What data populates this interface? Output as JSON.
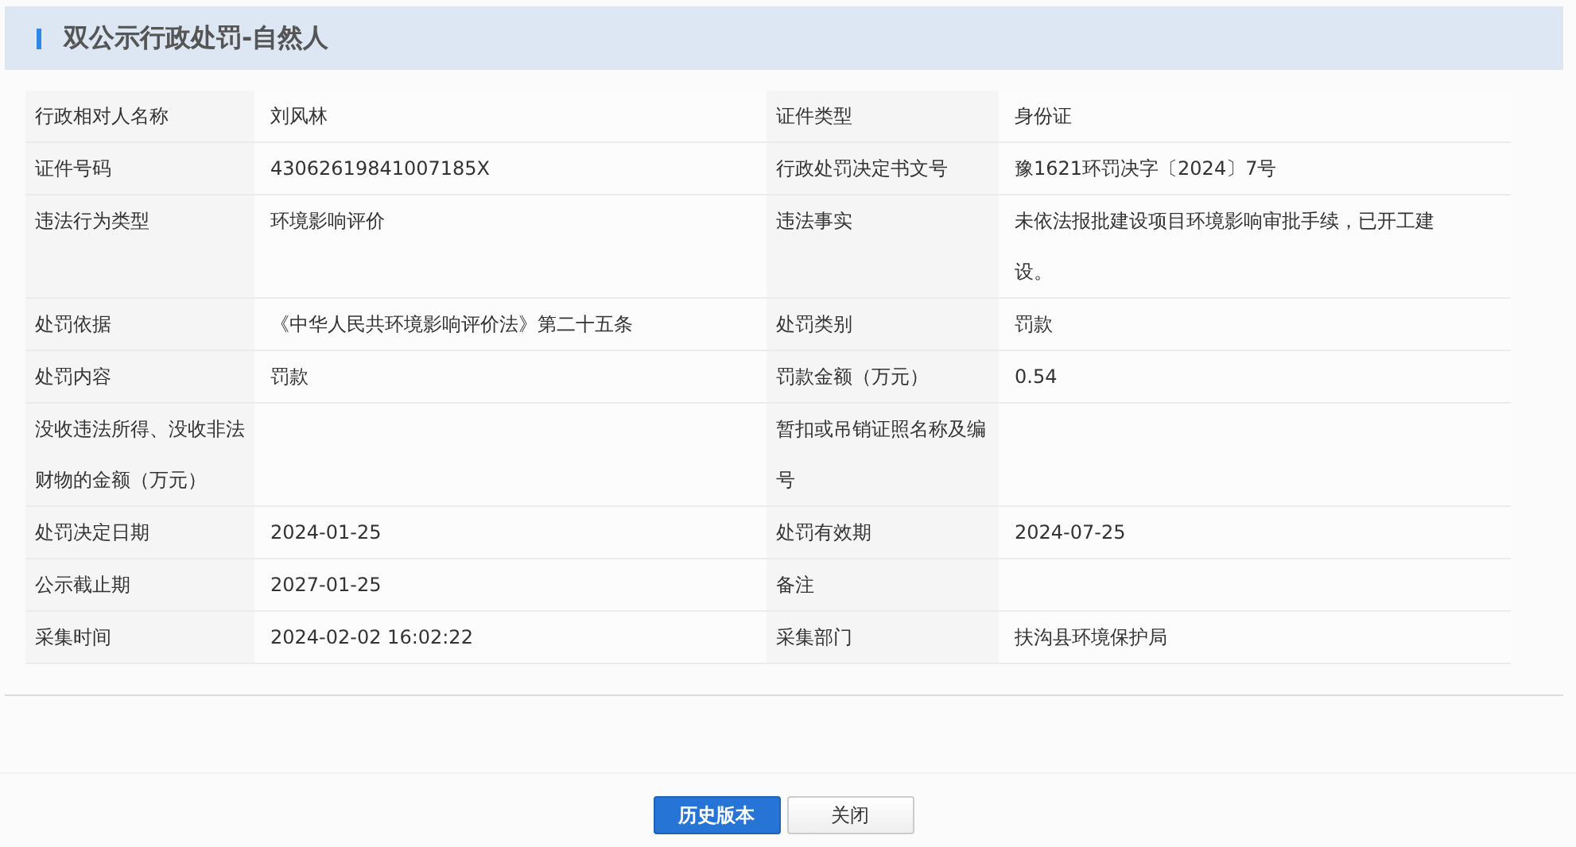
{
  "header": {
    "title": "双公示行政处罚-自然人"
  },
  "rows": [
    {
      "cells": [
        {
          "label": "行政相对人名称",
          "value": "刘风林"
        },
        {
          "label": "证件类型",
          "value": "身份证"
        }
      ]
    },
    {
      "cells": [
        {
          "label": "证件号码",
          "value": "43062619841007185X"
        },
        {
          "label": "行政处罚决定书文号",
          "value": "豫1621环罚决字〔2024〕7号"
        }
      ]
    },
    {
      "cells": [
        {
          "label": "违法行为类型",
          "value": "环境影响评价"
        },
        {
          "label": "违法事实",
          "value": "未依法报批建设项目环境影响审批手续，已开工建设。"
        }
      ]
    },
    {
      "cells": [
        {
          "label": "处罚依据",
          "value": "《中华人民共环境影响评价法》第二十五条"
        },
        {
          "label": "处罚类别",
          "value": "罚款"
        }
      ]
    },
    {
      "cells": [
        {
          "label": "处罚内容",
          "value": "罚款"
        },
        {
          "label": "罚款金额（万元）",
          "value": "0.54"
        }
      ]
    },
    {
      "cells": [
        {
          "label": "没收违法所得、没收非法财物的金额（万元）"
        },
        {
          "label": "暂扣或吊销证照名称及编号"
        }
      ]
    },
    {
      "cells": [
        {
          "label": "处罚决定日期",
          "value": "2024-01-25"
        },
        {
          "label": "处罚有效期",
          "value": "2024-07-25"
        }
      ]
    },
    {
      "cells": [
        {
          "label": "公示截止期",
          "value": "2027-01-25"
        },
        {
          "label": "备注"
        }
      ]
    },
    {
      "cells": [
        {
          "label": "采集时间",
          "value": "2024-02-02 16:02:22"
        },
        {
          "label": "采集部门",
          "value": "扶沟县环境保护局"
        }
      ]
    }
  ],
  "buttons": [
    {
      "label": "历史版本",
      "kind": "primary"
    },
    {
      "label": "关闭",
      "kind": "default"
    }
  ]
}
